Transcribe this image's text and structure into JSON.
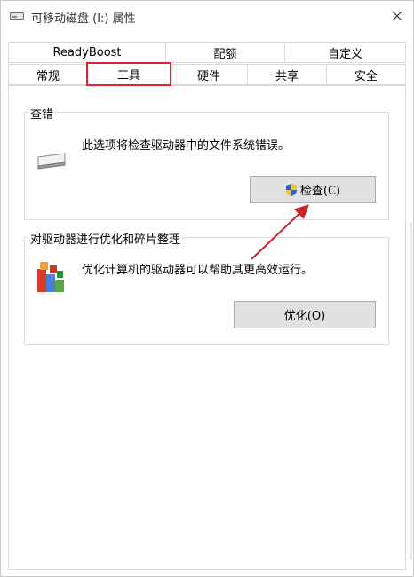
{
  "window": {
    "title": "可移动磁盘 (I:) 属性"
  },
  "tabs_row1": [
    "ReadyBoost",
    "配额",
    "自定义"
  ],
  "tabs_row2": [
    "常规",
    "工具",
    "硬件",
    "共享",
    "安全"
  ],
  "active_tab": "工具",
  "check_group": {
    "title": "查错",
    "description": "此选项将检查驱动器中的文件系统错误。",
    "button_label": "检查(C)"
  },
  "optimize_group": {
    "title": "对驱动器进行优化和碎片整理",
    "description": "优化计算机的驱动器可以帮助其更高效运行。",
    "button_label": "优化(O)"
  },
  "colors": {
    "highlight": "#d9252b",
    "arrow": "#c8252b",
    "button_bg": "#e1e1e1"
  },
  "icons": [
    "drive-icon",
    "close-icon",
    "shield-icon",
    "defrag-icon"
  ]
}
